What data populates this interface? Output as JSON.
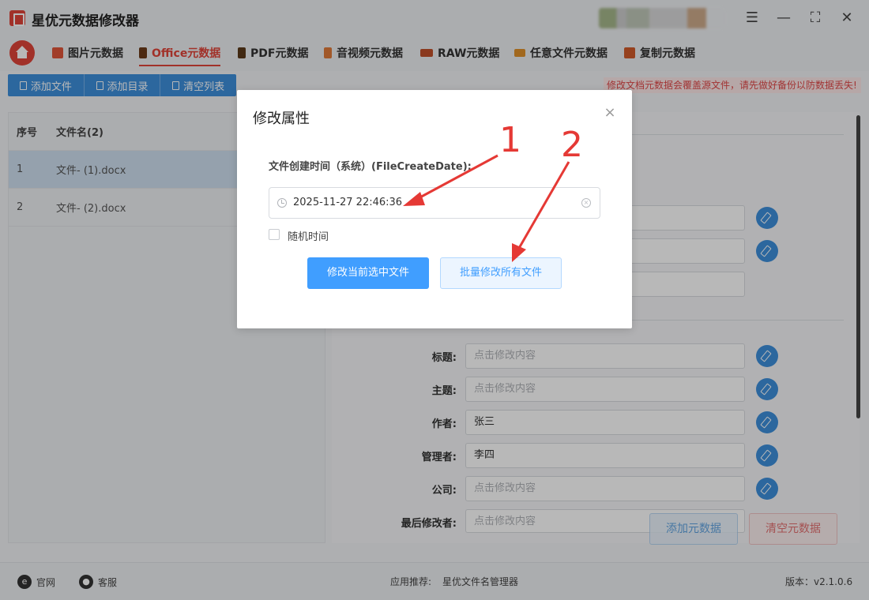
{
  "app": {
    "title": "星优元数据修改器"
  },
  "tabs": [
    {
      "label": "图片元数据",
      "color": "#e0553a"
    },
    {
      "label": "Office元数据",
      "color": "#6b3b1a"
    },
    {
      "label": "PDF元数据",
      "color": "#5a3a1a"
    },
    {
      "label": "音视频元数据",
      "color": "#e07a3a"
    },
    {
      "label": "RAW元数据",
      "color": "#c0502a"
    },
    {
      "label": "任意文件元数据",
      "color": "#e0902a"
    },
    {
      "label": "复制元数据",
      "color": "#d05a2a"
    }
  ],
  "toolbar": {
    "add_file": "添加文件",
    "add_dir": "添加目录",
    "clear_list": "清空列表"
  },
  "warning": "修改文档元数据会覆盖源文件，请先做好备份以防数据丢失!",
  "file_list": {
    "headers": {
      "no": "序号",
      "name": "文件名(2)"
    },
    "rows": [
      {
        "no": "1",
        "name": "文件- (1).docx"
      },
      {
        "no": "2",
        "name": "文件- (2).docx"
      }
    ]
  },
  "properties": {
    "title_label": "标题:",
    "title_placeholder": "点击修改内容",
    "subject_label": "主题:",
    "subject_placeholder": "点击修改内容",
    "author_label": "作者:",
    "author_value": "张三",
    "manager_label": "管理者:",
    "manager_value": "李四",
    "company_label": "公司:",
    "company_placeholder": "点击修改内容",
    "last_modifier_label": "最后修改者:",
    "last_modifier_placeholder": "点击修改内容"
  },
  "actions": {
    "add_meta": "添加元数据",
    "clear_meta": "清空元数据"
  },
  "statusbar": {
    "website": "官网",
    "service": "客服",
    "recommend_label": "应用推荐:",
    "recommend_app": "星优文件名管理器",
    "version": "版本：v2.1.0.6"
  },
  "dialog": {
    "title": "修改属性",
    "close": "×",
    "field_label": "文件创建时间（系统）(FileCreateDate):",
    "date_value": "2025-11-27 22:46:36",
    "random_label": "随机时间",
    "modify_current": "修改当前选中文件",
    "modify_all": "批量修改所有文件"
  },
  "annotations": {
    "one": "1",
    "two": "2",
    "color": "#e53935"
  },
  "colors": {
    "accent": "#409eff",
    "brand": "#e0453a"
  }
}
